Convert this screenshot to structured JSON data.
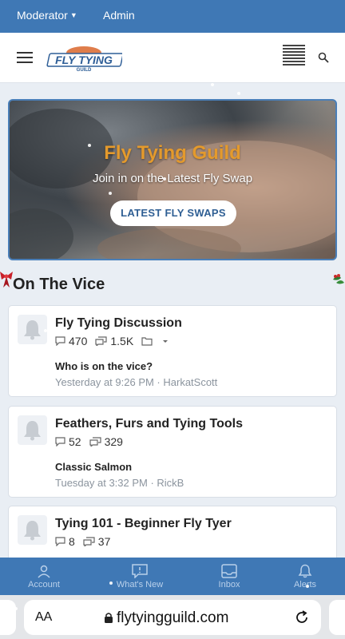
{
  "topbar": {
    "moderator_label": "Moderator",
    "admin_label": "Admin"
  },
  "header": {
    "logo_text": "FLY TYING",
    "logo_subtext": "GUILD"
  },
  "banner": {
    "title": "Fly Tying Guild",
    "subtitle": "Join in on the Latest Fly Swap",
    "cta_label": "LATEST FLY SWAPS"
  },
  "section": {
    "title": "On The Vice"
  },
  "forums": [
    {
      "name": "Fly Tying Discussion",
      "threads": "470",
      "messages": "1.5K",
      "latest_title": "Who is on the vice?",
      "latest_meta": "Yesterday at 9:26 PM · HarkatScott"
    },
    {
      "name": "Feathers, Furs and Tying Tools",
      "threads": "52",
      "messages": "329",
      "latest_title": "Classic Salmon",
      "latest_meta": "Tuesday at 3:32 PM · RickB"
    },
    {
      "name": "Tying 101 - Beginner Fly Tyer",
      "threads": "8",
      "messages": "37"
    }
  ],
  "bottom_nav": [
    {
      "label": "Account",
      "icon": "user-icon"
    },
    {
      "label": "What's New",
      "icon": "whats-new-icon"
    },
    {
      "label": "Inbox",
      "icon": "inbox-icon"
    },
    {
      "label": "Alerts",
      "icon": "bell-icon"
    }
  ],
  "browser": {
    "aa_label": "AA",
    "url": "flytyingguild.com"
  },
  "colors": {
    "brand": "#3f78b5",
    "banner_title": "#e49a2c",
    "cta_text": "#2f5f94"
  }
}
